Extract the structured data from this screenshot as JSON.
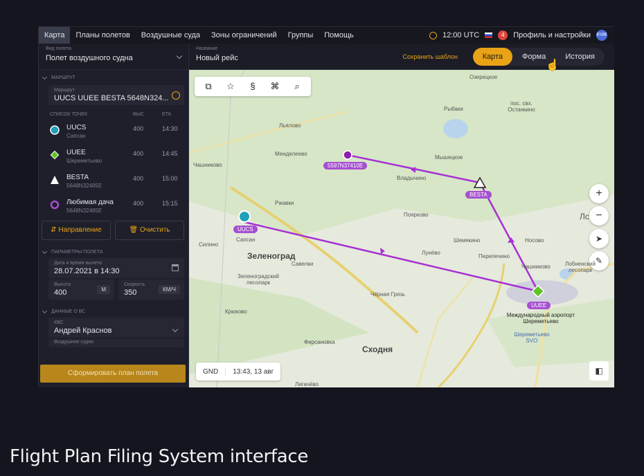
{
  "nav": {
    "items": [
      "Карта",
      "Планы полетов",
      "Воздушные суда",
      "Зоны ограничений",
      "Группы",
      "Помощь"
    ],
    "time": "12:00 UTC",
    "notifications": "4",
    "profile": "Профиль и настройки",
    "avatar": "КЧЖ"
  },
  "header": {
    "type_label": "Вид полета",
    "type_value": "Полет воздушного судна",
    "name_label": "Название",
    "name_value": "Новый рейс",
    "save_template": "Сохранить шаблон",
    "tabs": [
      "Карта",
      "Форма",
      "История"
    ]
  },
  "route": {
    "section": "Маршрут",
    "route_label": "Маршрут",
    "route_value": "UUCS UUEE BESTA 5648N324...",
    "list_header": "Список точек",
    "col_alt": "Выс",
    "col_eta": "ETA",
    "points": [
      {
        "name": "UUCS",
        "sub": "Сапсан",
        "alt": "400",
        "eta": "14:30",
        "icon": "airport-teal"
      },
      {
        "name": "UUEE",
        "sub": "Шереметьево",
        "alt": "400",
        "eta": "14:45",
        "icon": "airport-green"
      },
      {
        "name": "BESTA",
        "sub": "5648N32485E",
        "alt": "400",
        "eta": "15:00",
        "icon": "triangle-white"
      },
      {
        "name": "Любимая дача",
        "sub": "5648N32485E",
        "alt": "400",
        "eta": "15:15",
        "icon": "pin-purple"
      }
    ],
    "direction_btn": "Направление",
    "clear_btn": "Очистить"
  },
  "params": {
    "section": "Параметры полета",
    "date_label": "Дата и время вылета",
    "date_value": "28.07.2021 в 14:30",
    "alt_label": "Высота",
    "alt_value": "400",
    "alt_unit": "М",
    "speed_label": "Скорость",
    "speed_value": "350",
    "speed_unit": "КМ/Ч"
  },
  "aircraft": {
    "section": "Данные о ВС",
    "pic_label": "КВС",
    "pic_value": "Андрей Краснов",
    "vessel_label": "Воздушное судно"
  },
  "submit": "Сформировать план полета",
  "map": {
    "status_mode": "GND",
    "status_time": "13:43, 13 авг",
    "labels": [
      "Озерецкое",
      "Рыбаки",
      "пос. свх. Останкино",
      "Льялово",
      "Менделеево",
      "Мышецкое",
      "Владычино",
      "Чашниково",
      "Ржавки",
      "Поярково",
      "Шемякино",
      "Носово",
      "Сапсан",
      "Зеленоград",
      "Савелки",
      "Зеленоградский лесопарк",
      "Лунёво",
      "Перепечино",
      "Чашниково",
      "Лобненский лесопарк",
      "Международный аэропорт Шереметьево",
      "Шереметьево SVO",
      "Чёрная Грязь",
      "Фирсановка",
      "Сходня",
      "Крюково",
      "Силино",
      "Лигачёво",
      "Лс"
    ],
    "waypoints": {
      "uucs": "UUCS",
      "uuee": "UUEE",
      "besta": "BESTA",
      "custom": "5597N37410E"
    }
  },
  "caption": "Flight Plan Filing System interface",
  "colors": {
    "accent": "#e8a317",
    "route": "#a64fd0"
  }
}
